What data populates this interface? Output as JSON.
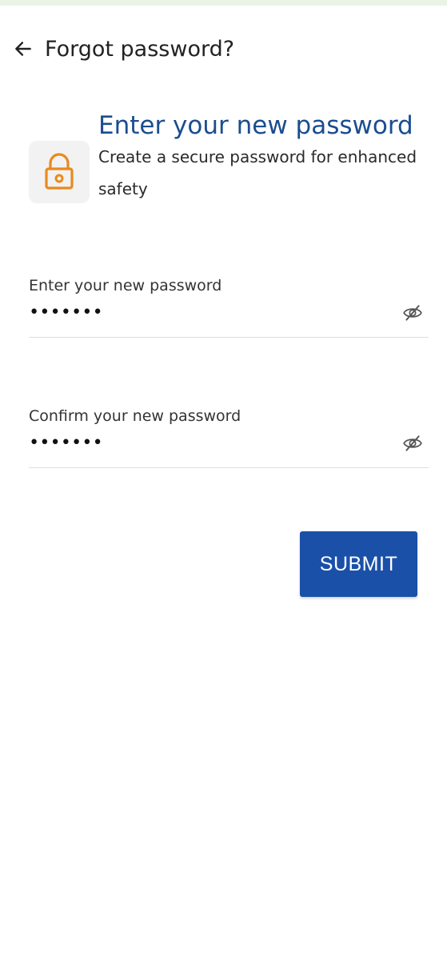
{
  "header": {
    "title": "Forgot password?",
    "back_icon": "arrow-left-icon"
  },
  "hero": {
    "icon": "lock-icon",
    "icon_color": "#e98a1d",
    "title": "Enter your new password",
    "subtitle": "Create a secure password for enhanced safety"
  },
  "form": {
    "new_password": {
      "label": "Enter your new password",
      "value": "•••••••",
      "toggle_icon": "eye-off-icon"
    },
    "confirm_password": {
      "label": "Confirm your new password",
      "value": "•••••••",
      "toggle_icon": "eye-off-icon"
    },
    "submit_label": "SUBMIT"
  },
  "colors": {
    "primary": "#1b50a8",
    "title": "#1b4d8f",
    "accent": "#e98a1d",
    "top_strip": "#eaf3e4"
  }
}
